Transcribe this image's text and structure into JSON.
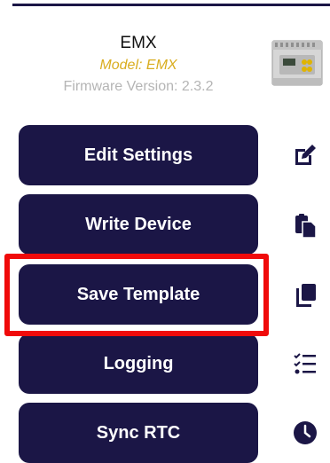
{
  "device": {
    "name": "EMX",
    "model": "Model: EMX",
    "firmware": "Firmware Version: 2.3.2",
    "image_icon": "energy-meter-device"
  },
  "actions": [
    {
      "label": "Edit Settings",
      "icon": "edit-icon"
    },
    {
      "label": "Write Device",
      "icon": "clipboard-icon"
    },
    {
      "label": "Save Template",
      "icon": "copy-icon"
    },
    {
      "label": "Logging",
      "icon": "checklist-icon"
    },
    {
      "label": "Sync RTC",
      "icon": "clock-icon"
    }
  ],
  "highlighted_action": "Save Template",
  "colors": {
    "button_bg": "#1b1646",
    "accent": "#d9ad1f",
    "highlight": "#f00a0a"
  }
}
